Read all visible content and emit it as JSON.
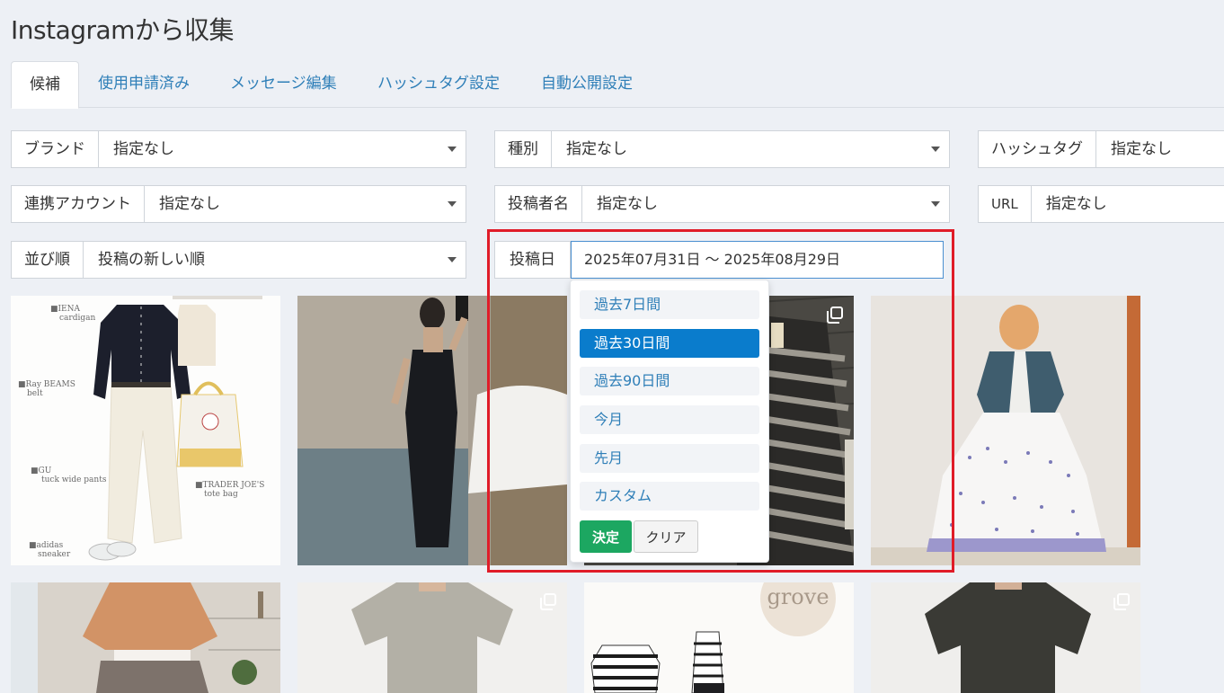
{
  "page": {
    "title": "Instagramから収集"
  },
  "tabs": [
    {
      "label": "候補",
      "active": true
    },
    {
      "label": "使用申請済み",
      "active": false
    },
    {
      "label": "メッセージ編集",
      "active": false
    },
    {
      "label": "ハッシュタグ設定",
      "active": false
    },
    {
      "label": "自動公開設定",
      "active": false
    }
  ],
  "filters": {
    "brand": {
      "label": "ブランド",
      "value": "指定なし"
    },
    "type": {
      "label": "種別",
      "value": "指定なし"
    },
    "hashtag": {
      "label": "ハッシュタグ",
      "value": "指定なし"
    },
    "account": {
      "label": "連携アカウント",
      "value": "指定なし"
    },
    "poster": {
      "label": "投稿者名",
      "value": "指定なし"
    },
    "url": {
      "label": "URL",
      "value": "指定なし"
    },
    "sort": {
      "label": "並び順",
      "value": "投稿の新しい順"
    },
    "post_date": {
      "label": "投稿日",
      "value": "2025年07月31日 〜 2025年08月29日"
    }
  },
  "date_dropdown": {
    "options": [
      "過去7日間",
      "過去30日間",
      "過去90日間",
      "今月",
      "先月",
      "カスタム"
    ],
    "selected_index": 1,
    "apply_label": "決定",
    "clear_label": "クリア"
  },
  "photo1_labels": {
    "l1": "■IENA",
    "l1b": "cardigan",
    "l2": "■Ray BEAMS",
    "l2b": "belt",
    "l3": "■GU",
    "l3b": "tuck wide pants",
    "l4": "■TRADER JOE'S",
    "l4b": "tote bag",
    "l5": "■adidas",
    "l5b": "sneaker"
  },
  "photo7_logo": "grove",
  "colors": {
    "accent": "#0a7ccc",
    "apply": "#1ca761",
    "highlight": "#e01c28",
    "link": "#2f7fb8"
  }
}
